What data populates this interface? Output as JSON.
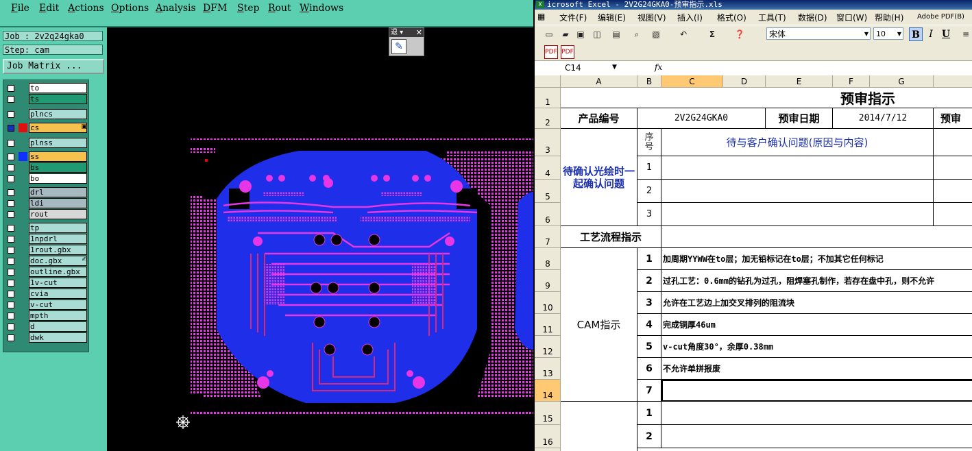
{
  "cam": {
    "menu": [
      "File",
      "Edit",
      "Actions",
      "Options",
      "Analysis",
      "DFM",
      "Step",
      "Rout",
      "Windows"
    ],
    "job_label": "Job : 2v2q24gka0",
    "step_label": "Step: cam",
    "job_matrix_button": "Job Matrix ...",
    "layers": [
      {
        "name": "to",
        "bg": "#ffffff",
        "check": "off",
        "swatch": ""
      },
      {
        "name": "ts",
        "bg": "#1f9a72",
        "check": "off",
        "swatch": ""
      },
      {
        "name": "plncs",
        "bg": "#a8dcd4",
        "check": "off",
        "swatch": ""
      },
      {
        "name": "cs",
        "bg": "#f7c14d",
        "check": "on",
        "swatch": "#e01010",
        "icon": "▣"
      },
      {
        "name": "plnss",
        "bg": "#a8dcd4",
        "check": "off",
        "swatch": ""
      },
      {
        "name": "ss",
        "bg": "#f7c14d",
        "check": "off",
        "swatch": "#1030ff"
      },
      {
        "name": "bs",
        "bg": "#1f9a72",
        "check": "off",
        "swatch": ""
      },
      {
        "name": "bo",
        "bg": "#ffffff",
        "check": "off",
        "swatch": ""
      },
      {
        "name": "drl",
        "bg": "#a6b8c0",
        "check": "off",
        "swatch": ""
      },
      {
        "name": "ldi",
        "bg": "#a6b8c0",
        "check": "off",
        "swatch": ""
      },
      {
        "name": "rout",
        "bg": "#d8d8d8",
        "check": "off",
        "swatch": ""
      },
      {
        "name": "tp",
        "bg": "#a8dcd4",
        "check": "off",
        "swatch": ""
      },
      {
        "name": "1npdrl",
        "bg": "#a8dcd4",
        "check": "off",
        "swatch": ""
      },
      {
        "name": "1rout.gbx",
        "bg": "#a8dcd4",
        "check": "off",
        "swatch": ""
      },
      {
        "name": "doc.gbx",
        "bg": "#a8dcd4",
        "check": "off",
        "swatch": "",
        "icon": "✍"
      },
      {
        "name": "outline.gbx",
        "bg": "#a8dcd4",
        "check": "off",
        "swatch": ""
      },
      {
        "name": "1v-cut",
        "bg": "#a8dcd4",
        "check": "off",
        "swatch": ""
      },
      {
        "name": "cvia",
        "bg": "#a8dcd4",
        "check": "off",
        "swatch": ""
      },
      {
        "name": "v-cut",
        "bg": "#a8dcd4",
        "check": "off",
        "swatch": ""
      },
      {
        "name": "mpth",
        "bg": "#a8dcd4",
        "check": "off",
        "swatch": ""
      },
      {
        "name": "d",
        "bg": "#a8dcd4",
        "check": "off",
        "swatch": ""
      },
      {
        "name": "dwk",
        "bg": "#a8dcd4",
        "check": "off",
        "swatch": ""
      }
    ],
    "mini_toolbar_title": "退 ▾",
    "mini_toolbar_close": "✕",
    "colors": {
      "board_blue": "#1f2ee8",
      "copper_magenta": "#e636e6",
      "trace_red": "#d8287a",
      "bg": "#000000"
    }
  },
  "excel": {
    "title": "icrosoft Excel - 2V2G24GKA0-预审指示.xls",
    "menu": [
      "文件(F)",
      "编辑(E)",
      "视图(V)",
      "插入(I)",
      "格式(O)",
      "工具(T)",
      "数据(D)",
      "窗口(W)",
      "帮助(H)",
      "Adobe PDF(B)"
    ],
    "font_name": "宋体",
    "font_size": "10",
    "format_buttons": [
      "B",
      "I",
      "U"
    ],
    "name_box": "C14",
    "fx": "fx",
    "columns": [
      "A",
      "B",
      "C",
      "D",
      "E",
      "F",
      "G"
    ],
    "rows": [
      "1",
      "2",
      "3",
      "4",
      "5",
      "6",
      "7",
      "8",
      "9",
      "10",
      "11",
      "12",
      "13",
      "14",
      "15",
      "16"
    ],
    "sheet": {
      "title": "预审指示",
      "product_no_label": "产品编号",
      "product_no": "2V2G24GKA0",
      "review_date_label": "预审日期",
      "review_date": "2014/7/12",
      "review_cut": "预审",
      "confirm_group": "待确认光绘时一起确认问题",
      "seq_label": "序号",
      "pending_header": "待与客户确认问题(原因与内容)",
      "confirm_nums": [
        "1",
        "2",
        "3"
      ],
      "process_label": "工艺流程指示",
      "cam_label": "CAM指示",
      "cam_items": [
        {
          "no": "1",
          "text": "加周期YYWW在to层；加无铅标记在to层；不加其它任何标记"
        },
        {
          "no": "2",
          "text": "过孔工艺：0.6mm的钻孔为过孔，阻焊塞孔制作，若存在盘中孔，则不允许"
        },
        {
          "no": "3",
          "text": "允许在工艺边上加交叉排列的阻流块"
        },
        {
          "no": "4",
          "text": "完成铜厚46um"
        },
        {
          "no": "5",
          "text": "v-cut角度30°，余厚0.38mm"
        },
        {
          "no": "6",
          "text": "不允许单拼报废"
        },
        {
          "no": "7",
          "text": ""
        }
      ],
      "extra_nums": [
        "1",
        "2"
      ]
    }
  }
}
